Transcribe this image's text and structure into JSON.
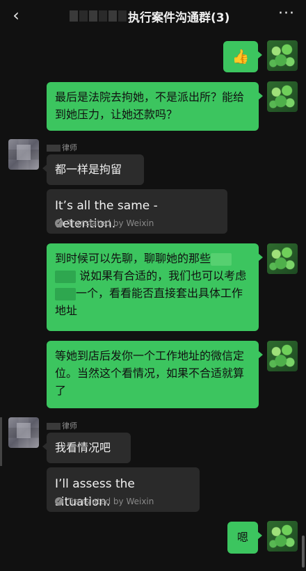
{
  "header": {
    "title": "执行案件沟通群(3)",
    "back_icon": "chevron-left-icon",
    "more_icon": "more-horizontal-icon"
  },
  "messages": [
    {
      "type": "out",
      "content_icon": "thumbs-up-icon"
    },
    {
      "type": "out",
      "text": "最后是法院去拘她，不是派出所？能给到她压力，让她还款吗？"
    },
    {
      "type": "in",
      "sender_suffix": "律师",
      "text": "都一样是拘留",
      "translation": "It’s all the same - detention.",
      "translated_by": "Translated by Weixin"
    },
    {
      "type": "out",
      "part1": "到时候可以先聊，聊聊她的那些",
      "part2": "说如果有合适的，我们也可以考虑",
      "part3": "一个，看看能否直接套出具体工作地址"
    },
    {
      "type": "out",
      "text": "等她到店后发你一个工作地址的微信定位。当然这个看情况，如果不合适就算了"
    },
    {
      "type": "in",
      "sender_suffix": "律师",
      "text": "我看情况吧",
      "translation": "I’ll assess the situation.",
      "translated_by": "Translated by Weixin"
    },
    {
      "type": "out",
      "text": "嗯"
    }
  ]
}
